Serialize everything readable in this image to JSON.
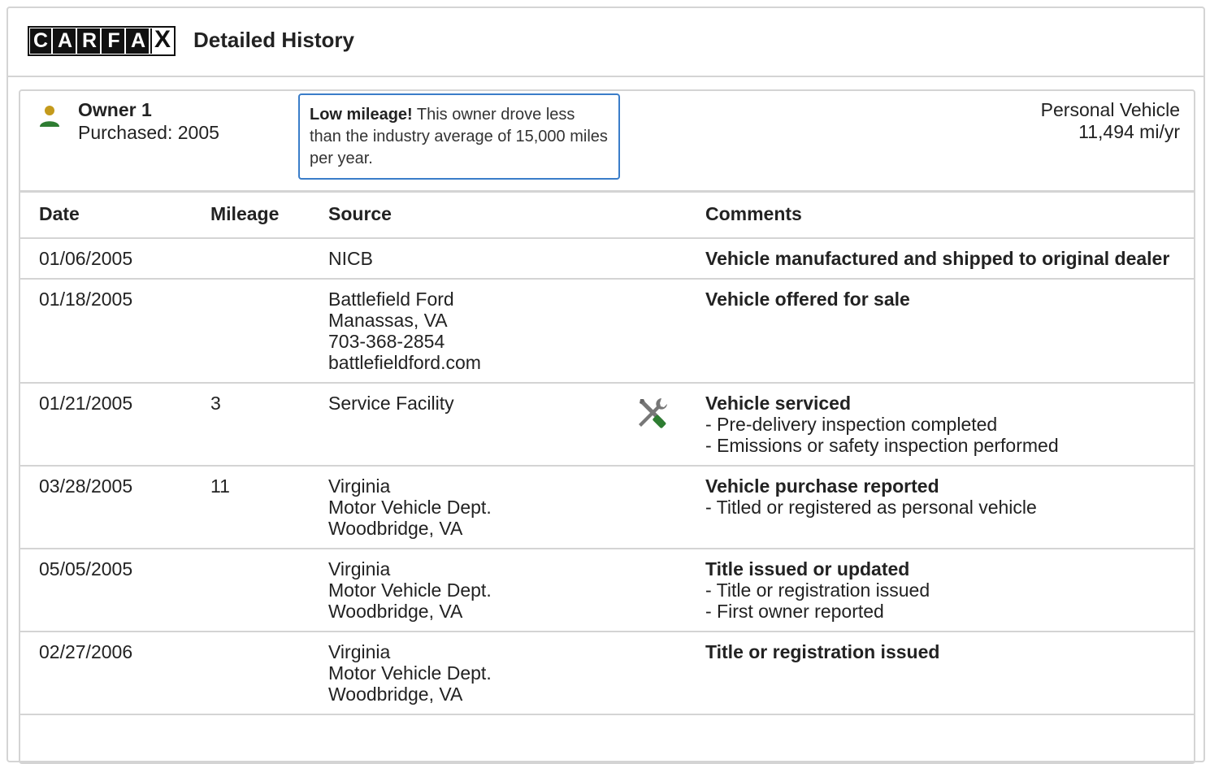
{
  "header": {
    "logo_letters": [
      "C",
      "A",
      "R",
      "F",
      "A",
      "X"
    ],
    "title": "Detailed History"
  },
  "owner": {
    "name": "Owner 1",
    "purchased": "Purchased: 2005",
    "notice_strong": "Low mileage!",
    "notice_text": " This owner drove less than the industry average of 15,000 miles per year.",
    "vehicle_type": "Personal Vehicle",
    "miles_per_year": "11,494 mi/yr"
  },
  "table": {
    "headers": {
      "date": "Date",
      "mileage": "Mileage",
      "source": "Source",
      "comments": "Comments"
    },
    "rows": [
      {
        "date": "01/06/2005",
        "mileage": "",
        "source": [
          "NICB"
        ],
        "icon": "",
        "comment_title": "Vehicle manufactured and shipped to original dealer",
        "comment_lines": []
      },
      {
        "date": "01/18/2005",
        "mileage": "",
        "source": [
          "Battlefield Ford",
          "Manassas, VA",
          "703-368-2854",
          "battlefieldford.com"
        ],
        "icon": "",
        "comment_title": "Vehicle offered for sale",
        "comment_lines": []
      },
      {
        "date": "01/21/2005",
        "mileage": "3",
        "source": [
          "Service Facility"
        ],
        "icon": "wrench-screwdriver-icon",
        "comment_title": "Vehicle serviced",
        "comment_lines": [
          "- Pre-delivery inspection completed",
          "- Emissions or safety inspection performed"
        ]
      },
      {
        "date": "03/28/2005",
        "mileage": "11",
        "source": [
          "Virginia",
          "Motor Vehicle Dept.",
          "Woodbridge, VA"
        ],
        "icon": "",
        "comment_title": "Vehicle purchase reported",
        "comment_lines": [
          "- Titled or registered as personal vehicle"
        ]
      },
      {
        "date": "05/05/2005",
        "mileage": "",
        "source": [
          "Virginia",
          "Motor Vehicle Dept.",
          "Woodbridge, VA"
        ],
        "icon": "",
        "comment_title": "Title issued or updated",
        "comment_lines": [
          "- Title or registration issued",
          "- First owner reported"
        ]
      },
      {
        "date": "02/27/2006",
        "mileage": "",
        "source": [
          "Virginia",
          "Motor Vehicle Dept.",
          "Woodbridge, VA"
        ],
        "icon": "",
        "comment_title": "Title or registration issued",
        "comment_lines": []
      }
    ]
  },
  "colors": {
    "person_head": "#c49a1c",
    "person_body": "#2e7d32",
    "notice_border": "#3a7dc9",
    "border": "#d4d4d4"
  }
}
